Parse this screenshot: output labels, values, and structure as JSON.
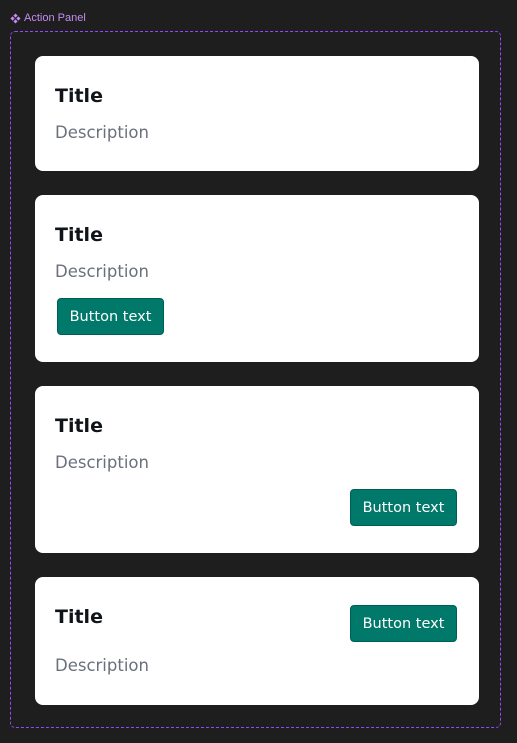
{
  "component": {
    "name": "Action Panel",
    "icon": "component-diamond-icon",
    "accent": "#9747ff"
  },
  "colors": {
    "background": "#1e1e1e",
    "card": "#ffffff",
    "title": "#101418",
    "description": "#6a707c",
    "button": "#00786a",
    "button_text": "#ffffff"
  },
  "cards": [
    {
      "title": "Title",
      "description": "Description"
    },
    {
      "title": "Title",
      "description": "Description",
      "button": "Button text"
    },
    {
      "title": "Title",
      "description": "Description",
      "button": "Button text"
    },
    {
      "title": "Title",
      "description": "Description",
      "button": "Button text"
    }
  ]
}
